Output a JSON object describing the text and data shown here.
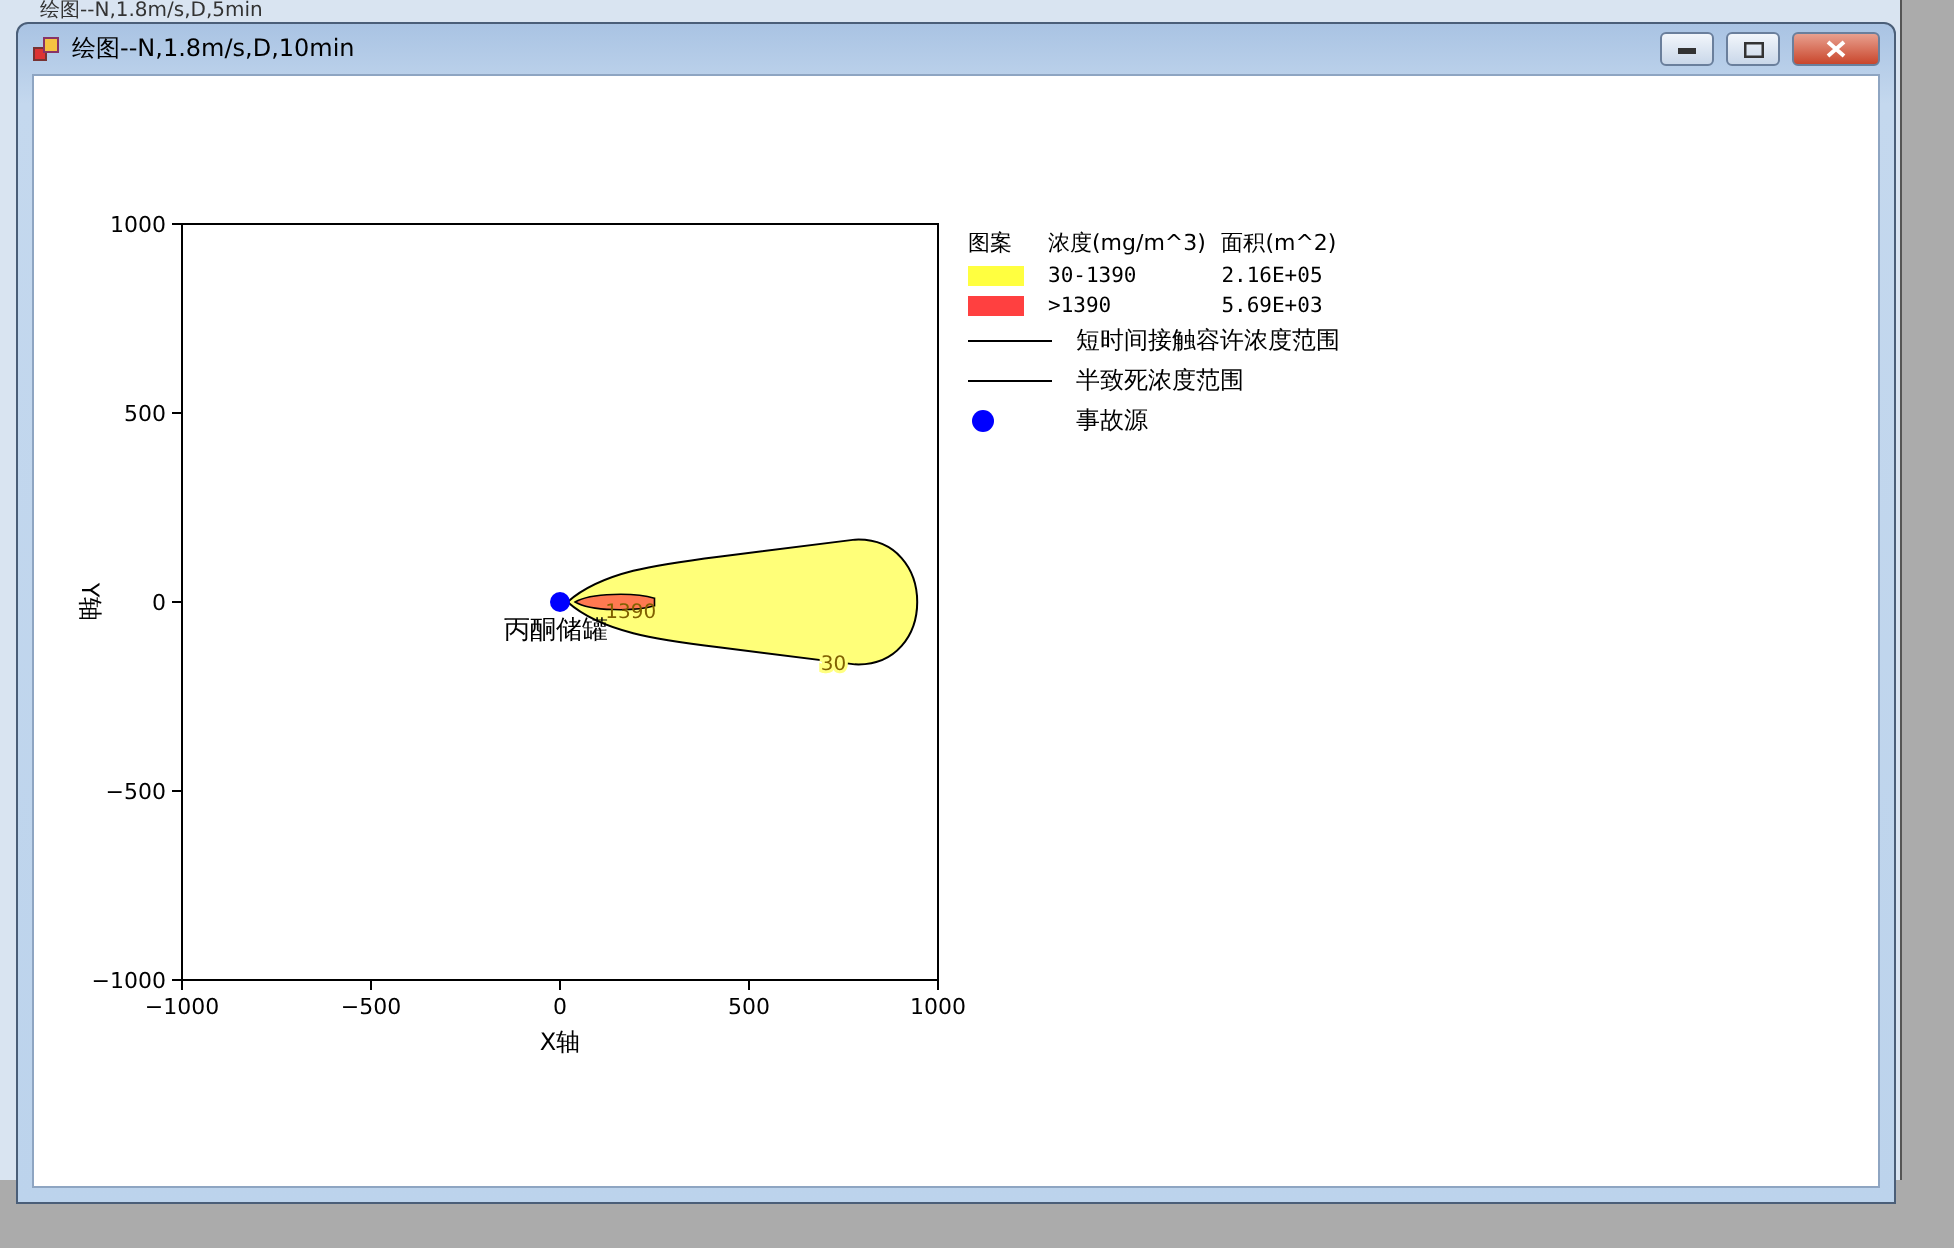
{
  "background_window": {
    "title": "绘图--N,1.8m/s,D,5min"
  },
  "window": {
    "title": "绘图--N,1.8m/s,D,10min"
  },
  "plot": {
    "chart_data": {
      "type": "scatter",
      "xlabel": "X轴",
      "ylabel": "Y轴",
      "x": [
        0
      ],
      "series": [
        {
          "name": "事故源",
          "color": "#0000ff",
          "values": [
            0
          ]
        }
      ],
      "xlim": [
        -1000,
        1000
      ],
      "ylim": [
        -1000,
        1000
      ],
      "xticks": [
        {
          "value": -1000,
          "label": "−1000"
        },
        {
          "value": -500,
          "label": "−500"
        },
        0,
        500,
        1000
      ],
      "yticks": [
        {
          "value": -1000,
          "label": "−1000"
        },
        {
          "value": -500,
          "label": "−500"
        },
        0,
        500,
        1000
      ],
      "annotations": [
        "丙酮储罐",
        "1390",
        "30"
      ]
    }
  },
  "legend": {
    "headers": [
      "图案",
      "浓度(mg/m^3)",
      "面积(m^2)"
    ],
    "items": [
      {
        "kind": "swatch",
        "color": "#ffff40",
        "range": "30-1390",
        "area": "2.16E+05"
      },
      {
        "kind": "swatch",
        "color": "#ff4040",
        "range": ">1390",
        "area": "5.69E+03"
      },
      {
        "kind": "line",
        "color": "#000000",
        "label": "短时间接触容许浓度范围"
      },
      {
        "kind": "line",
        "color": "#000000",
        "label": "半致死浓度范围"
      },
      {
        "kind": "dot"
      }
    ]
  }
}
